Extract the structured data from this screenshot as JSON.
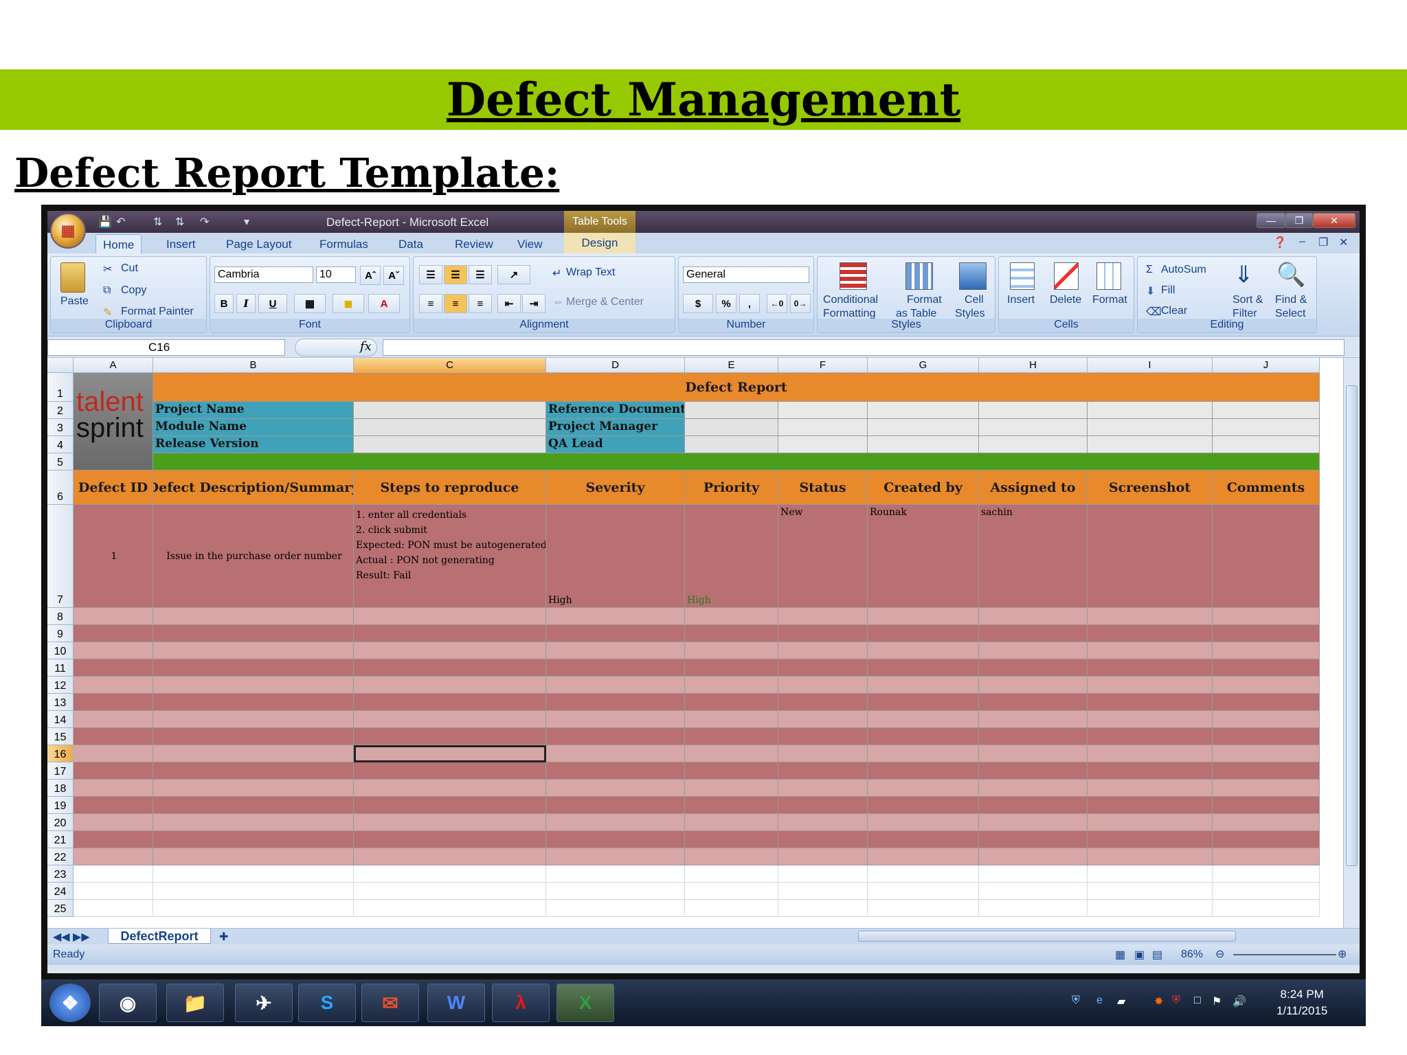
{
  "slide": {
    "banner": "Defect Management",
    "heading": "Defect Report Template:"
  },
  "window": {
    "title": "Defect-Report - Microsoft Excel",
    "context_tab_group": "Table Tools"
  },
  "tabs": [
    "Home",
    "Insert",
    "Page Layout",
    "Formulas",
    "Data",
    "Review",
    "View"
  ],
  "context_tab": "Design",
  "ribbon": {
    "clipboard": {
      "paste": "Paste",
      "cut": "Cut",
      "copy": "Copy",
      "format_painter": "Format Painter",
      "label": "Clipboard"
    },
    "font": {
      "family": "Cambria",
      "size": "10",
      "label": "Font",
      "bold": "B",
      "italic": "I",
      "underline": "U"
    },
    "alignment": {
      "wrap": "Wrap Text",
      "merge": "Merge & Center",
      "label": "Alignment"
    },
    "number": {
      "format": "General",
      "label": "Number",
      "currency": "$",
      "percent": "%",
      "comma": ","
    },
    "styles": {
      "cond1": "Conditional",
      "cond2": "Formatting",
      "fmt1": "Format",
      "fmt2": "as Table",
      "cell1": "Cell",
      "cell2": "Styles",
      "label": "Styles"
    },
    "cells": {
      "insert": "Insert",
      "delete": "Delete",
      "format": "Format",
      "label": "Cells"
    },
    "editing": {
      "autosum": "AutoSum",
      "fill": "Fill",
      "clear": "Clear",
      "sort1": "Sort &",
      "sort2": "Filter",
      "find1": "Find &",
      "find2": "Select",
      "label": "Editing"
    }
  },
  "formula_bar": {
    "name_box": "C16",
    "fx": "fx",
    "value": ""
  },
  "columns": [
    "A",
    "B",
    "C",
    "D",
    "E",
    "F",
    "G",
    "H",
    "I",
    "J"
  ],
  "logo": {
    "line1": "talent",
    "line2": "sprint"
  },
  "sheet": {
    "title": "Defect Report",
    "meta_left": [
      "Project Name",
      "Module Name",
      "Release Version"
    ],
    "meta_right": [
      "Reference Document",
      "Project Manager",
      "QA Lead"
    ],
    "headers": [
      "Defect ID",
      "Defect Description/Summary",
      "Steps to reproduce",
      "Severity",
      "Priority",
      "Status",
      "Created by",
      "Assigned to",
      "Screenshot",
      "Comments"
    ],
    "row": {
      "id": "1",
      "summary": "Issue in the purchase order number",
      "steps": [
        "1. enter all credentials",
        "2. click submit",
        "Expected: PON must be autogenerated",
        "Actual : PON not generating",
        "Result: Fail"
      ],
      "severity": "High",
      "priority": "High",
      "status": "New",
      "created_by": "Rounak",
      "assigned_to": "sachin"
    },
    "row_numbers": [
      "1",
      "2",
      "3",
      "4",
      "5",
      "6",
      "7",
      "8",
      "9",
      "10",
      "11",
      "12",
      "13",
      "14",
      "15",
      "16",
      "17",
      "18",
      "19",
      "20",
      "21",
      "22",
      "23",
      "24",
      "25"
    ],
    "selected_row": "16"
  },
  "sheet_tab": "DefectReport",
  "status": {
    "ready": "Ready",
    "zoom": "86%"
  },
  "clock": {
    "time": "8:24 PM",
    "date": "1/11/2015"
  },
  "colors": {
    "banner": "#97c900",
    "header_orange": "#e8892b",
    "label_teal": "#40a2b8",
    "green_bar": "#4a9e1c",
    "row_pink_light": "#d7a6a6",
    "row_pink_dark": "#b87072"
  }
}
